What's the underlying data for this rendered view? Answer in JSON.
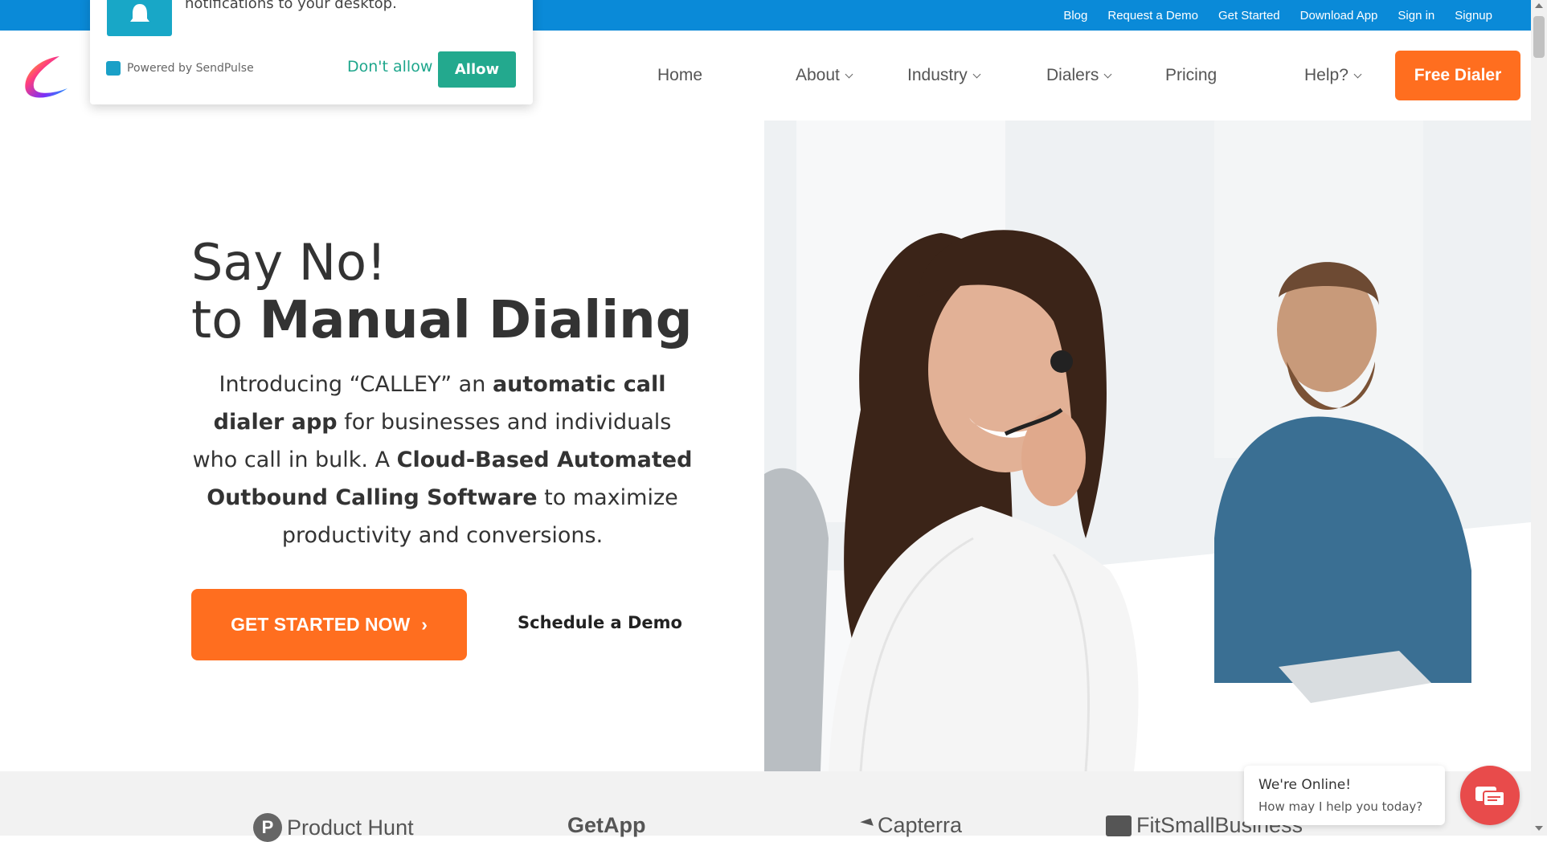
{
  "topbar": {
    "links": [
      "Blog",
      "Request a Demo",
      "Get Started",
      "Download App",
      "Sign in",
      "Signup"
    ]
  },
  "nav": {
    "home": "Home",
    "about": "About",
    "industry": "Industry",
    "dialers": "Dialers",
    "pricing": "Pricing",
    "help": "Help?",
    "free_dialer": "Free Dialer"
  },
  "hero": {
    "line1": "Say No!",
    "line2_prefix": "to ",
    "line2_bold": "Manual Dialing",
    "intro_1": "Introducing “CALLEY” an ",
    "intro_b1": "automatic call dialer app",
    "intro_2": " for businesses and individuals who call in bulk. A ",
    "intro_b2": "Cloud-Based Automated Outbound Calling Software",
    "intro_3": " to maximize productivity and conversions.",
    "cta": "GET STARTED NOW",
    "cta_arrow": "›",
    "demo": "Schedule a Demo"
  },
  "logos": [
    "Product Hunt",
    "GetApp",
    "Capterra",
    "FitSmallBusiness"
  ],
  "popup": {
    "text": "notifications to your desktop.",
    "powered": "Powered by SendPulse",
    "dont_allow": "Don't allow",
    "allow": "Allow"
  },
  "chat": {
    "title": "We're Online!",
    "subtitle": "How may I help you today?"
  },
  "colors": {
    "topbar": "#0a8ad8",
    "accent_orange": "#ff6e1f",
    "popup_green": "#23a98e",
    "chat_red": "#e84b4b"
  }
}
